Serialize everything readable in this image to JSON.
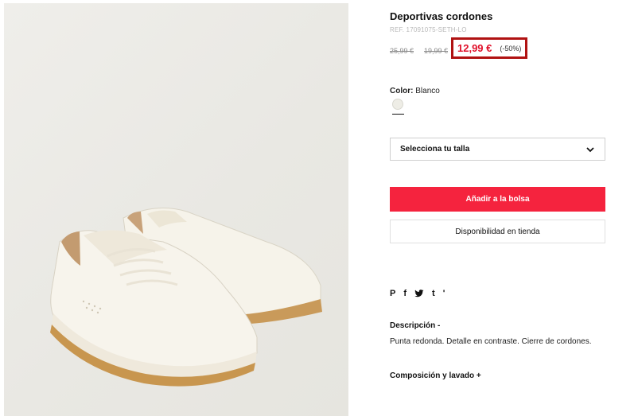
{
  "product": {
    "title": "Deportivas cordones",
    "ref": "REF. 17091075-SETH-LO",
    "old_price_1": "25,99 €",
    "old_price_2": "19,99 €",
    "price": "12,99 €",
    "discount": "(-50%)"
  },
  "color": {
    "label": "Color:",
    "value": "Blanco",
    "swatch_hex": "#eeede6"
  },
  "size": {
    "placeholder": "Selecciona tu talla"
  },
  "actions": {
    "add_to_bag": "Añadir a la bolsa",
    "store_availability": "Disponibilidad en tienda"
  },
  "share": {
    "icons": [
      "pinterest-icon",
      "facebook-icon",
      "twitter-icon",
      "tumblr-icon"
    ],
    "pinterest": "P",
    "facebook": "f",
    "tumblr": "t",
    "extra": "'"
  },
  "description": {
    "heading": "Descripción -",
    "text": "Punta redonda. Detalle en contraste. Cierre de cordones."
  },
  "composition": {
    "heading": "Composición y lavado +"
  },
  "colors": {
    "accent": "#f5233e",
    "price": "#e0112b",
    "highlight_box": "#b01212"
  }
}
